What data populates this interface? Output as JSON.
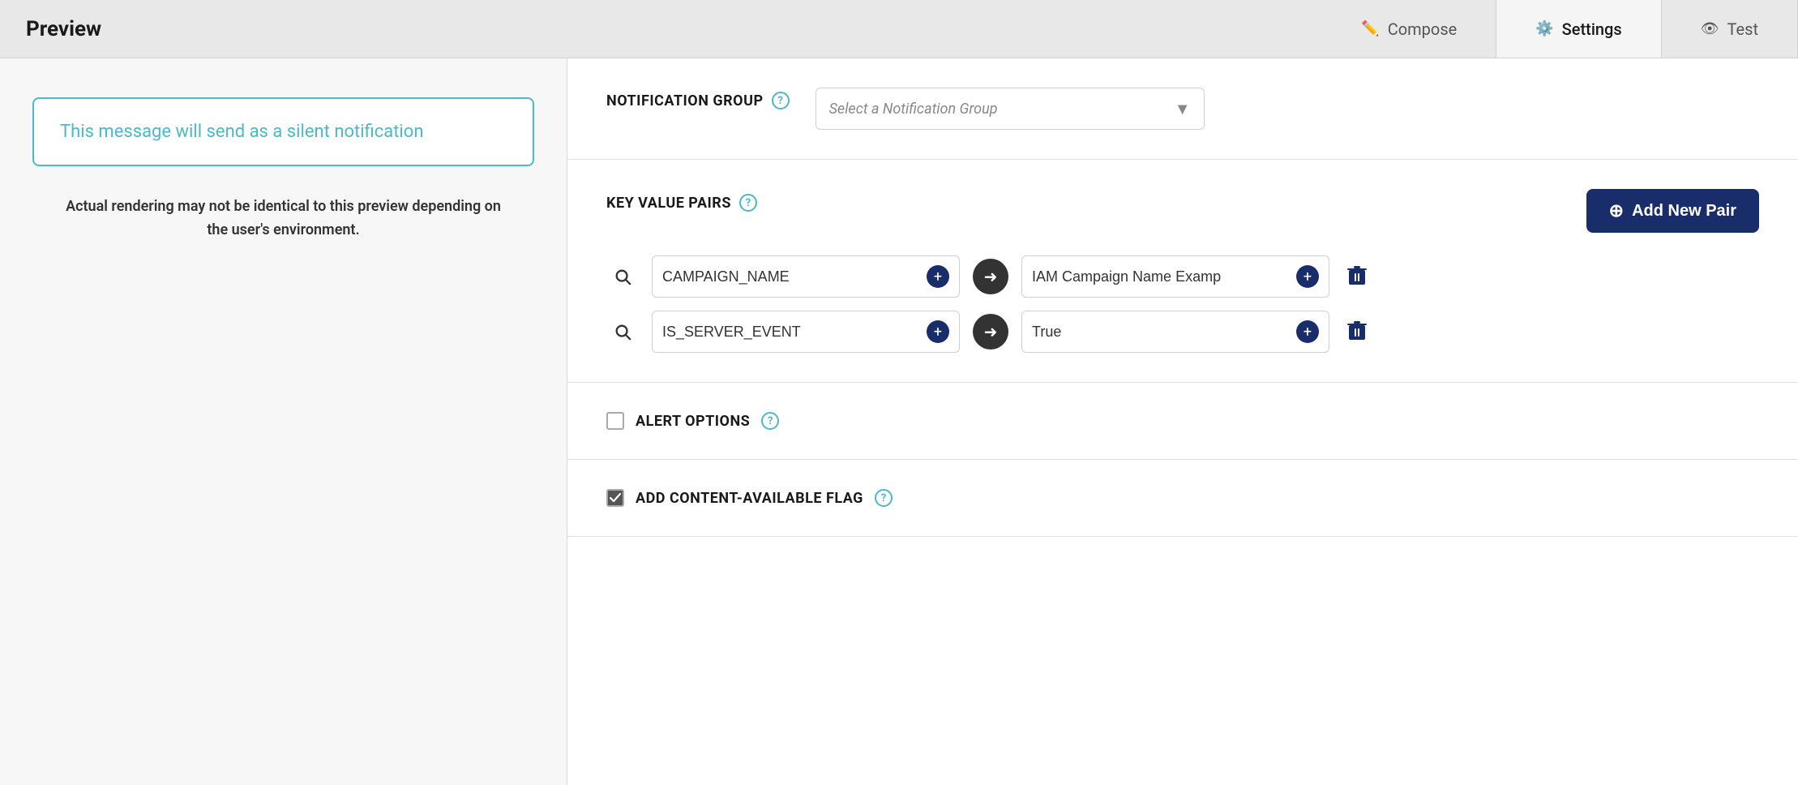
{
  "header": {
    "title": "Preview",
    "tabs": [
      {
        "id": "compose",
        "label": "Compose",
        "icon": "✏️",
        "active": false
      },
      {
        "id": "settings",
        "label": "Settings",
        "icon": "⚙️",
        "active": true
      },
      {
        "id": "test",
        "label": "Test",
        "icon": "👁",
        "active": false
      }
    ]
  },
  "left_panel": {
    "silent_notification": "This message will send as a silent notification",
    "rendering_note": "Actual rendering may not be identical to this preview depending on\nthe user's environment."
  },
  "right_panel": {
    "notification_group": {
      "label": "NOTIFICATION GROUP",
      "placeholder": "Select a Notification Group",
      "help_tooltip": "?"
    },
    "key_value_pairs": {
      "label": "KEY VALUE PAIRS",
      "help_tooltip": "?",
      "add_button_label": "Add New Pair",
      "rows": [
        {
          "key": "CAMPAIGN_NAME",
          "value": "IAM Campaign Name Examp",
          "key_placeholder": "CAMPAIGN_NAME",
          "value_placeholder": "IAM Campaign Name Examp"
        },
        {
          "key": "IS_SERVER_EVENT",
          "value": "True",
          "key_placeholder": "IS_SERVER_EVENT",
          "value_placeholder": "True"
        }
      ]
    },
    "alert_options": {
      "label": "ALERT OPTIONS",
      "help_tooltip": "?",
      "checked": false
    },
    "content_available_flag": {
      "label": "ADD CONTENT-AVAILABLE FLAG",
      "help_tooltip": "?",
      "checked": true
    }
  },
  "colors": {
    "teal": "#4db8c8",
    "dark_blue": "#1a2d6b",
    "light_gray": "#f7f7f7",
    "border_gray": "#d0d0d0"
  }
}
